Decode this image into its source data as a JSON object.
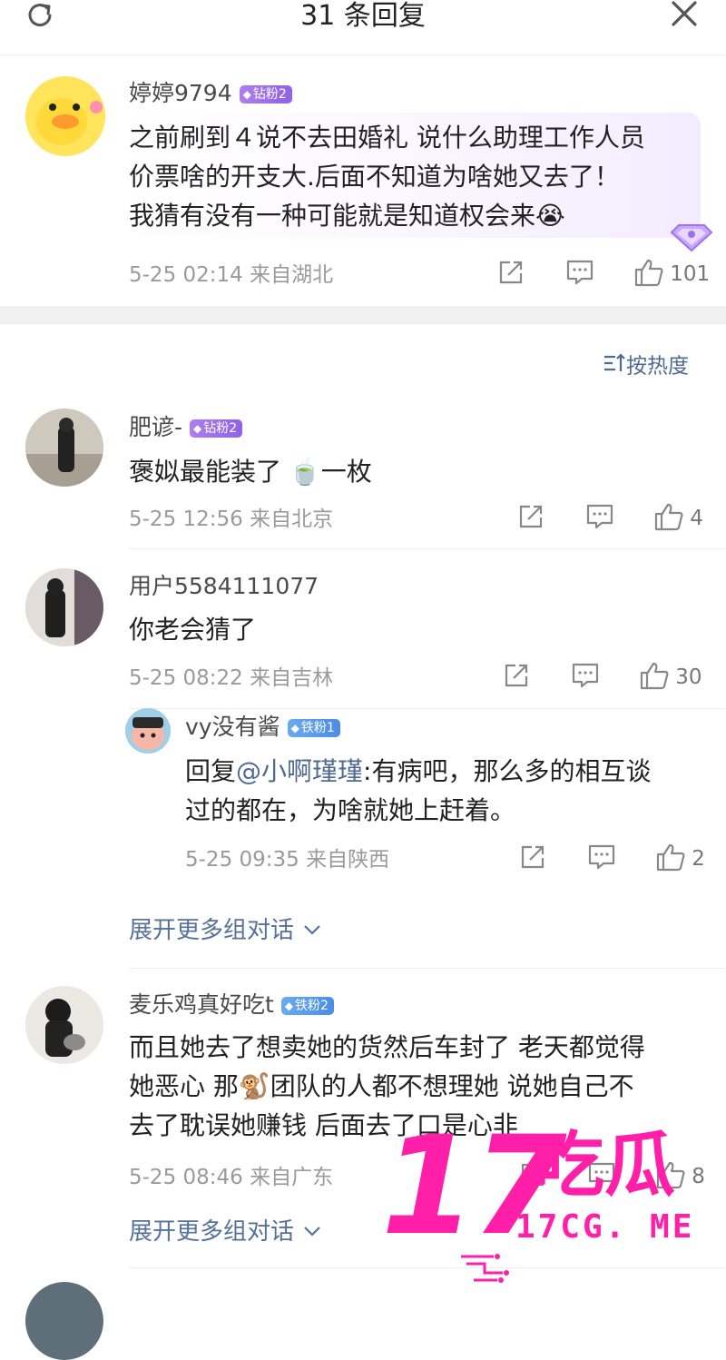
{
  "header": {
    "title": "31 条回复"
  },
  "main_comment": {
    "username": "婷婷9794",
    "badge": "钻粉2",
    "lines": [
      "之前刷到４说不去田婚礼 说什么助理工作人员",
      "价票啥的开支大.后面不知道为啥她又去了！",
      "我猜有没有一种可能就是知道权会来"
    ],
    "emoji": "😭",
    "meta": "5-25 02:14 来自湖北",
    "likes": "101"
  },
  "sort": {
    "label": "按热度"
  },
  "replies": [
    {
      "username": "肥谚-",
      "badge": "钻粉2",
      "text_before": "褒姒最能装了 ",
      "emoji": "🍵",
      "text_after": "一枚",
      "meta": "5-25 12:56 来自北京",
      "likes": "4"
    },
    {
      "username": "用户5584111077",
      "text": "你老会猜了",
      "meta": "5-25 08:22 来自吉林",
      "likes": "30",
      "sub_reply": {
        "username": "vy没有酱",
        "badge": "铁粉1",
        "reply_prefix": "回复",
        "mention": "@小啊瑾瑾",
        "line1": ":有病吧，那么多的相互谈",
        "line2": "过的都在，为啥就她上赶着。",
        "meta": "5-25 09:35 来自陕西",
        "likes": "2"
      },
      "expand_label": "展开更多组对话"
    },
    {
      "username": "麦乐鸡真好吃t",
      "badge": "铁粉2",
      "lines": [
        "而且她去了想卖她的货然后车封了 老天都觉得",
        "她恶心 那🐒团队的人都不想理她 说她自己不",
        "去了耽误她赚钱 后面去了口是心非"
      ],
      "meta": "5-25 08:46 来自广东",
      "likes": "8",
      "expand_label": "展开更多组对话"
    }
  ],
  "watermark": {
    "number": "17",
    "chinese": "吃瓜",
    "url": "17CG. ME"
  },
  "colors": {
    "diamond_badge": "#9b6ef0",
    "iron_badge": "#5a9cee",
    "link": "#4f6b92",
    "watermark": "#ff1fa8"
  }
}
